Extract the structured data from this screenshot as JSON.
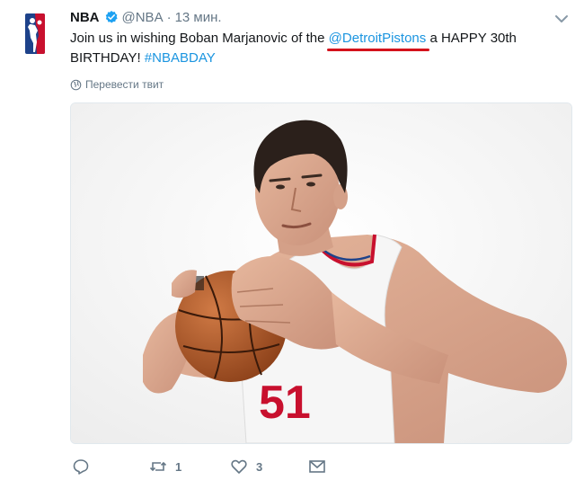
{
  "tweet": {
    "author_name": "NBA",
    "handle": "@NBA",
    "separator": "·",
    "time": "13 мин.",
    "text_before": "Join us in wishing Boban Marjanovic of the ",
    "mention": "@DetroitPistons",
    "text_after": " a HAPPY 30th BIRTHDAY! ",
    "hashtag": "#NBABDAY",
    "translate_label": "Перевести твит",
    "jersey_number": "51",
    "actions": {
      "reply_count": "",
      "retweet_count": "1",
      "like_count": "3"
    }
  },
  "colors": {
    "link": "#1b95e0",
    "secondary_text": "#657786",
    "annotation_underline": "#d4121c",
    "nba_blue": "#1d428a",
    "nba_red": "#c8102e"
  },
  "icons": {
    "logo": "nba-logo",
    "verified": "verified-badge-icon",
    "menu": "chevron-down-icon",
    "translate": "globe-icon",
    "reply": "reply-icon",
    "retweet": "retweet-icon",
    "like": "heart-icon",
    "message": "envelope-icon"
  }
}
